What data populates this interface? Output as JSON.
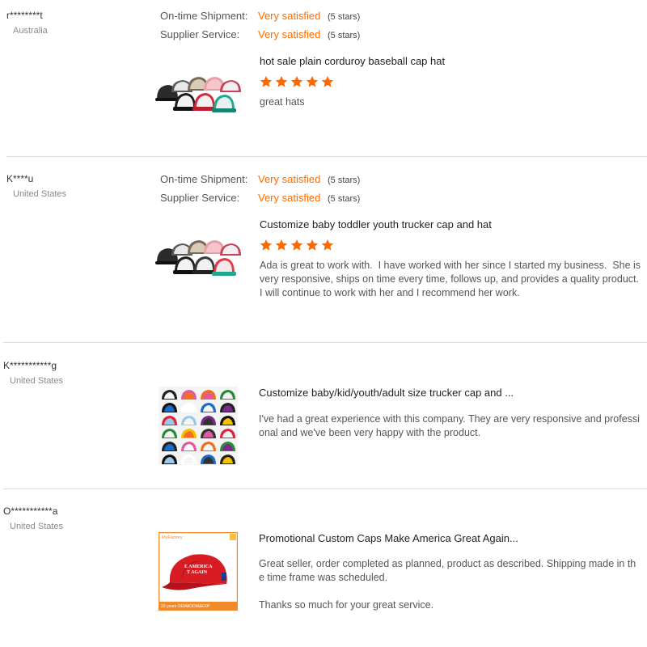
{
  "reviews": [
    {
      "buyer": "r********t",
      "country": "Australia",
      "ratings": [
        {
          "label": "On-time Shipment:",
          "value": "Very satisfied",
          "stars": "(5 stars)"
        },
        {
          "label": "Supplier Service:",
          "value": "Very satisfied",
          "stars": "(5 stars)"
        }
      ],
      "product": "hot sale plain corduroy baseball cap hat",
      "product_stars": 5,
      "text": "great hats",
      "image": "caps-group-icon"
    },
    {
      "buyer": "K****u",
      "country": "United States",
      "ratings": [
        {
          "label": "On-time Shipment:",
          "value": "Very satisfied",
          "stars": "(5 stars)"
        },
        {
          "label": "Supplier Service:",
          "value": "Very satisfied",
          "stars": "(5 stars)"
        }
      ],
      "product": "Customize baby toddler youth trucker cap and hat",
      "product_stars": 5,
      "text": "Ada is great to work with.  I have worked with her since I started my business.  She is very responsive, ships on time every time, follows up, and provides a quality product.  I will continue to work with her and I recommend her work.",
      "image": "caps-group-icon"
    },
    {
      "buyer": "K***********g",
      "country": "United States",
      "product": "Customize baby/kid/youth/adult size trucker cap and ...",
      "text": "I've had a great experience with this company. They are very responsive and professional and we've been very happy with the product.",
      "image": "caps-grid-icon"
    },
    {
      "buyer": "O***********a",
      "country": "United States",
      "product": "Promotional Custom Caps Make America Great Again...",
      "text": "Great seller, order completed as planned, product as described. Shipping made in the time frame was scheduled.\n\nThanks so much for your great service.",
      "image": "red-cap-icon",
      "image_text": {
        "brand": "MyFactory",
        "cap_line1": "E AMERICA",
        "cap_line2": "T AGAIN",
        "footer": "20 years OEM&ODM&EXP"
      }
    }
  ],
  "colors": {
    "accent": "#ff6a00",
    "divider": "#dcdcdc"
  }
}
